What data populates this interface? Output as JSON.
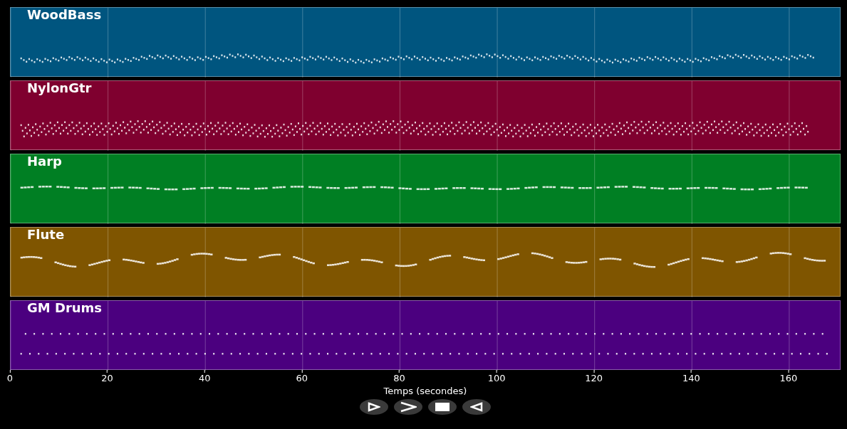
{
  "tracks": [
    {
      "name": "WoodBass",
      "color": "#00557f"
    },
    {
      "name": "NylonGtr",
      "color": "#7f002f"
    },
    {
      "name": "Harp",
      "color": "#007f23"
    },
    {
      "name": "Flute",
      "color": "#7f5500"
    },
    {
      "name": "GM Drums",
      "color": "#4b007f"
    }
  ],
  "time_axis": {
    "ticks": [
      "0",
      "20",
      "40",
      "60",
      "80",
      "100",
      "120",
      "140",
      "160"
    ],
    "label": "Temps (secondes)"
  },
  "buttons": [
    {
      "kind": "play"
    },
    {
      "kind": "next"
    },
    {
      "kind": "stop"
    },
    {
      "kind": "back"
    }
  ]
}
